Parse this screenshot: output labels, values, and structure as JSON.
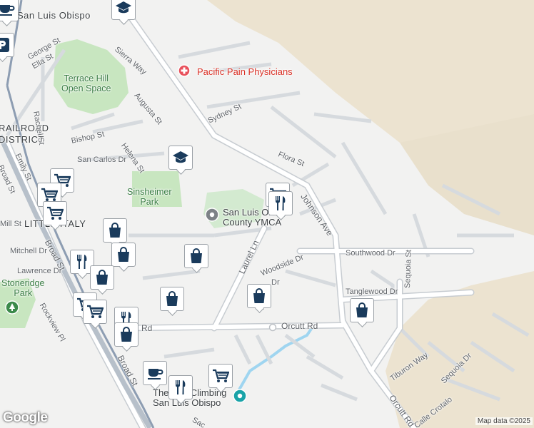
{
  "map": {
    "labels": {
      "city": "San Luis Obispo",
      "railroad_district": "RAILROAD\nDISTRICT",
      "little_italy": "LITTLE ITALY",
      "terrace_hill": "Terrace Hill\nOpen Space",
      "sinsheimer": "Sinsheimer\nPark",
      "stoneridge": "Stoneridge\nPark",
      "ymca": "San Luis Obispo\nCounty YMCA",
      "pacific_pain": "Pacific Pain Physicians",
      "climbing": "The Pad Climbing\nSan Luis Obispo"
    },
    "streets": {
      "george": "George St",
      "ella": "Ella St",
      "rachel": "Rachel St",
      "sierra": "Sierra Way",
      "augusta": "Augusta St",
      "sydney": "Sydney St",
      "bishop": "Bishop St",
      "helena": "Helena St",
      "san_carlos": "San Carlos Dr",
      "flora": "Flora St",
      "johnson": "Johnson Ave",
      "emily": "Emily St",
      "broad": "Broad St",
      "broad2": "Broad St",
      "broad_top": "Broad St",
      "mitchell": "Mitchell Dr",
      "lawrence": "Lawrence Dr",
      "laurel": "Laurel Ln",
      "woodside": "Woodside Dr",
      "southwood": "Southwood Dr",
      "sequoia": "Sequoia St",
      "tanglewood": "Tanglewood Dr",
      "orcutt": "Orcutt Rd",
      "orcutt_left": "Rd",
      "orcutt_diag": "Orcutt Rd",
      "tiburon": "Tiburon Way",
      "sequoia_dr": "Sequoia Dr",
      "calle_crotalo": "Calle Crotalo",
      "rockview": "Rockview Pl",
      "mill": "Mill St",
      "fl": "Fl",
      "dr": "Dr",
      "sac": "Sac"
    },
    "attribution": {
      "logo": "Google",
      "data": "Map data ©2025"
    },
    "colors": {
      "background": "#f2f2f1",
      "park": "#c8e6c0",
      "hills": "#ece3d0",
      "road": "#ffffff",
      "road_outline": "#c7ccd1",
      "rail": "#8d9db2",
      "creek": "#9fd5f0",
      "marker": "#1a3b5c",
      "medical": "#e8505b",
      "park_marker": "#3b8a4a"
    },
    "markers": [
      {
        "type": "coffee-icon"
      },
      {
        "type": "school-icon"
      },
      {
        "type": "parking-icon"
      },
      {
        "type": "school-icon"
      },
      {
        "type": "grocery-icon"
      },
      {
        "type": "grocery-icon"
      },
      {
        "type": "grocery-icon"
      },
      {
        "type": "shopping-icon"
      },
      {
        "type": "grocery-icon"
      },
      {
        "type": "restaurant-icon"
      },
      {
        "type": "shopping-icon"
      },
      {
        "type": "shopping-icon"
      },
      {
        "type": "restaurant-icon"
      },
      {
        "type": "shopping-icon"
      },
      {
        "type": "shopping-icon"
      },
      {
        "type": "shopping-icon"
      },
      {
        "type": "grocery-icon"
      },
      {
        "type": "grocery-icon"
      },
      {
        "type": "restaurant-icon"
      },
      {
        "type": "shopping-icon"
      },
      {
        "type": "shopping-icon"
      },
      {
        "type": "coffee-icon"
      },
      {
        "type": "restaurant-icon"
      },
      {
        "type": "grocery-icon"
      }
    ]
  }
}
